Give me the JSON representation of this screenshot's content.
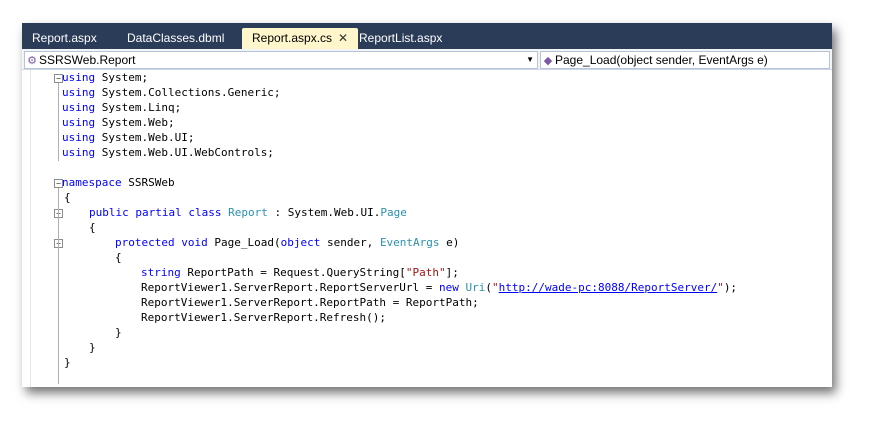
{
  "tabs": [
    {
      "label": "Report.aspx",
      "active": false
    },
    {
      "label": "DataClasses.dbml",
      "active": false
    },
    {
      "label": "Report.aspx.cs",
      "active": true
    },
    {
      "label": "ReportList.aspx",
      "active": false
    }
  ],
  "close_glyph": "✕",
  "nav": {
    "class_dropdown": "SSRSWeb.Report",
    "member_dropdown": "Page_Load(object sender, EventArgs e)"
  },
  "code": {
    "u1_kw": "using",
    "u1": " System;",
    "u2_kw": "using",
    "u2": " System.Collections.Generic;",
    "u3_kw": "using",
    "u3": " System.Linq;",
    "u4_kw": "using",
    "u4": " System.Web;",
    "u5_kw": "using",
    "u5": " System.Web.UI;",
    "u6_kw": "using",
    "u6": " System.Web.UI.WebControls;",
    "ns_kw": "namespace",
    "ns_name": " SSRSWeb",
    "brace_open": "{",
    "brace_close": "}",
    "cls_kw": "public partial class",
    "cls_name": "Report",
    "cls_sep": " : System.Web.UI.",
    "cls_base": "Page",
    "m_kw1": "protected void",
    "m_name": " Page_Load(",
    "m_kw2": "object",
    "m_p1": " sender, ",
    "m_ty": "EventArgs",
    "m_p2": " e)",
    "s1_kw": "string",
    "s1_a": " ReportPath = Request.QueryString[",
    "s1_str": "\"Path\"",
    "s1_b": "];",
    "s2_a": "ReportViewer1.ServerReport.ReportServerUrl = ",
    "s2_kw": "new",
    "s2_sp": " ",
    "s2_ty": "Uri",
    "s2_p": "(",
    "s2_q1": "\"",
    "s2_url": "http://wade-pc:8088/ReportServer/",
    "s2_q2": "\"",
    "s2_end": ");",
    "s3": "ReportViewer1.ServerReport.ReportPath = ReportPath;",
    "s4": "ReportViewer1.ServerReport.Refresh();"
  }
}
